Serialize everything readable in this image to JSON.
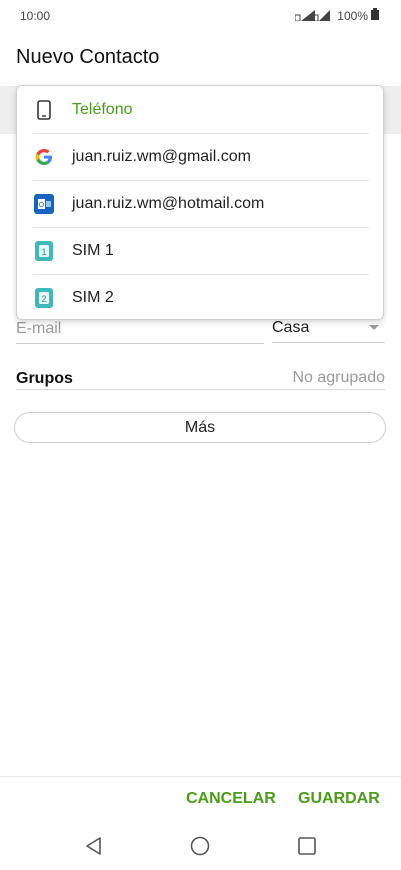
{
  "status_bar": {
    "time": "10:00",
    "battery": "100%"
  },
  "header": {
    "title": "Nuevo Contacto"
  },
  "account_dropdown": {
    "items": [
      {
        "label": "Teléfono",
        "icon": "phone-icon",
        "selected": true
      },
      {
        "label": "juan.ruiz.wm@gmail.com",
        "icon": "google-icon",
        "selected": false
      },
      {
        "label": "juan.ruiz.wm@hotmail.com",
        "icon": "outlook-icon",
        "selected": false
      },
      {
        "label": "SIM 1",
        "icon": "sim1-icon",
        "selected": false
      },
      {
        "label": "SIM 2",
        "icon": "sim2-icon",
        "selected": false
      }
    ]
  },
  "email": {
    "placeholder": "E-mail",
    "value": "",
    "type_value": "Casa"
  },
  "groups": {
    "label": "Grupos",
    "value": "No agrupado"
  },
  "more_button": "Más",
  "actions": {
    "cancel": "CANCELAR",
    "save": "GUARDAR"
  },
  "colors": {
    "accent": "#4a9d17",
    "sim": "#3fb8b8",
    "outlook": "#1565c0"
  }
}
